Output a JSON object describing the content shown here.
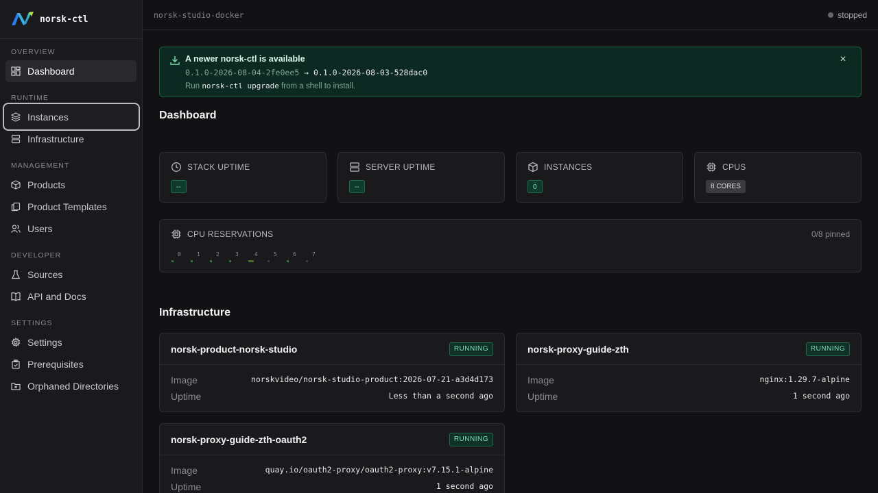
{
  "app": {
    "name": "norsk-ctl"
  },
  "sidebar": {
    "sections": {
      "overview": "OVERVIEW",
      "runtime": "RUNTIME",
      "management": "MANAGEMENT",
      "developer": "DEVELOPER",
      "settings": "SETTINGS"
    },
    "items": {
      "dashboard": "Dashboard",
      "instances": "Instances",
      "infrastructure": "Infrastructure",
      "products": "Products",
      "product_templates": "Product Templates",
      "users": "Users",
      "sources": "Sources",
      "api_docs": "API and Docs",
      "settings": "Settings",
      "prerequisites": "Prerequisites",
      "orphaned": "Orphaned Directories"
    }
  },
  "topbar": {
    "crumb": "norsk-studio-docker",
    "status": "stopped"
  },
  "banner": {
    "title": "A newer norsk-ctl is available",
    "from_version": "0.1.0-2026-08-04-2fe0ee5",
    "arrow": "→",
    "to_version": "0.1.0-2026-08-03-528dac0",
    "hint_pre": "Run",
    "hint_cmd": "norsk-ctl upgrade",
    "hint_post": "from a shell to install.",
    "close": "×"
  },
  "dashboard": {
    "title": "Dashboard",
    "stats": [
      {
        "label": "STACK UPTIME",
        "value": "--"
      },
      {
        "label": "SERVER UPTIME",
        "value": "--"
      },
      {
        "label": "INSTANCES",
        "value": "0"
      },
      {
        "label": "CPUS",
        "value": "8 CORES"
      }
    ],
    "cpu": {
      "label": "CPU RESERVATIONS",
      "pinned": "0/8 pinned",
      "cores": [
        "0",
        "1",
        "2",
        "3",
        "4",
        "5",
        "6",
        "7"
      ]
    }
  },
  "infrastructure": {
    "title": "Infrastructure",
    "image_label": "Image",
    "uptime_label": "Uptime",
    "cards": [
      {
        "name": "norsk-product-norsk-studio",
        "status": "RUNNING",
        "image": "norskvideo/norsk-studio-product:2026-07-21-a3d4d173",
        "uptime": "Less than a second ago"
      },
      {
        "name": "norsk-proxy-guide-zth",
        "status": "RUNNING",
        "image": "nginx:1.29.7-alpine",
        "uptime": "1 second ago"
      },
      {
        "name": "norsk-proxy-guide-zth-oauth2",
        "status": "RUNNING",
        "image": "quay.io/oauth2-proxy/oauth2-proxy:v7.15.1-alpine",
        "uptime": "1 second ago"
      }
    ]
  }
}
